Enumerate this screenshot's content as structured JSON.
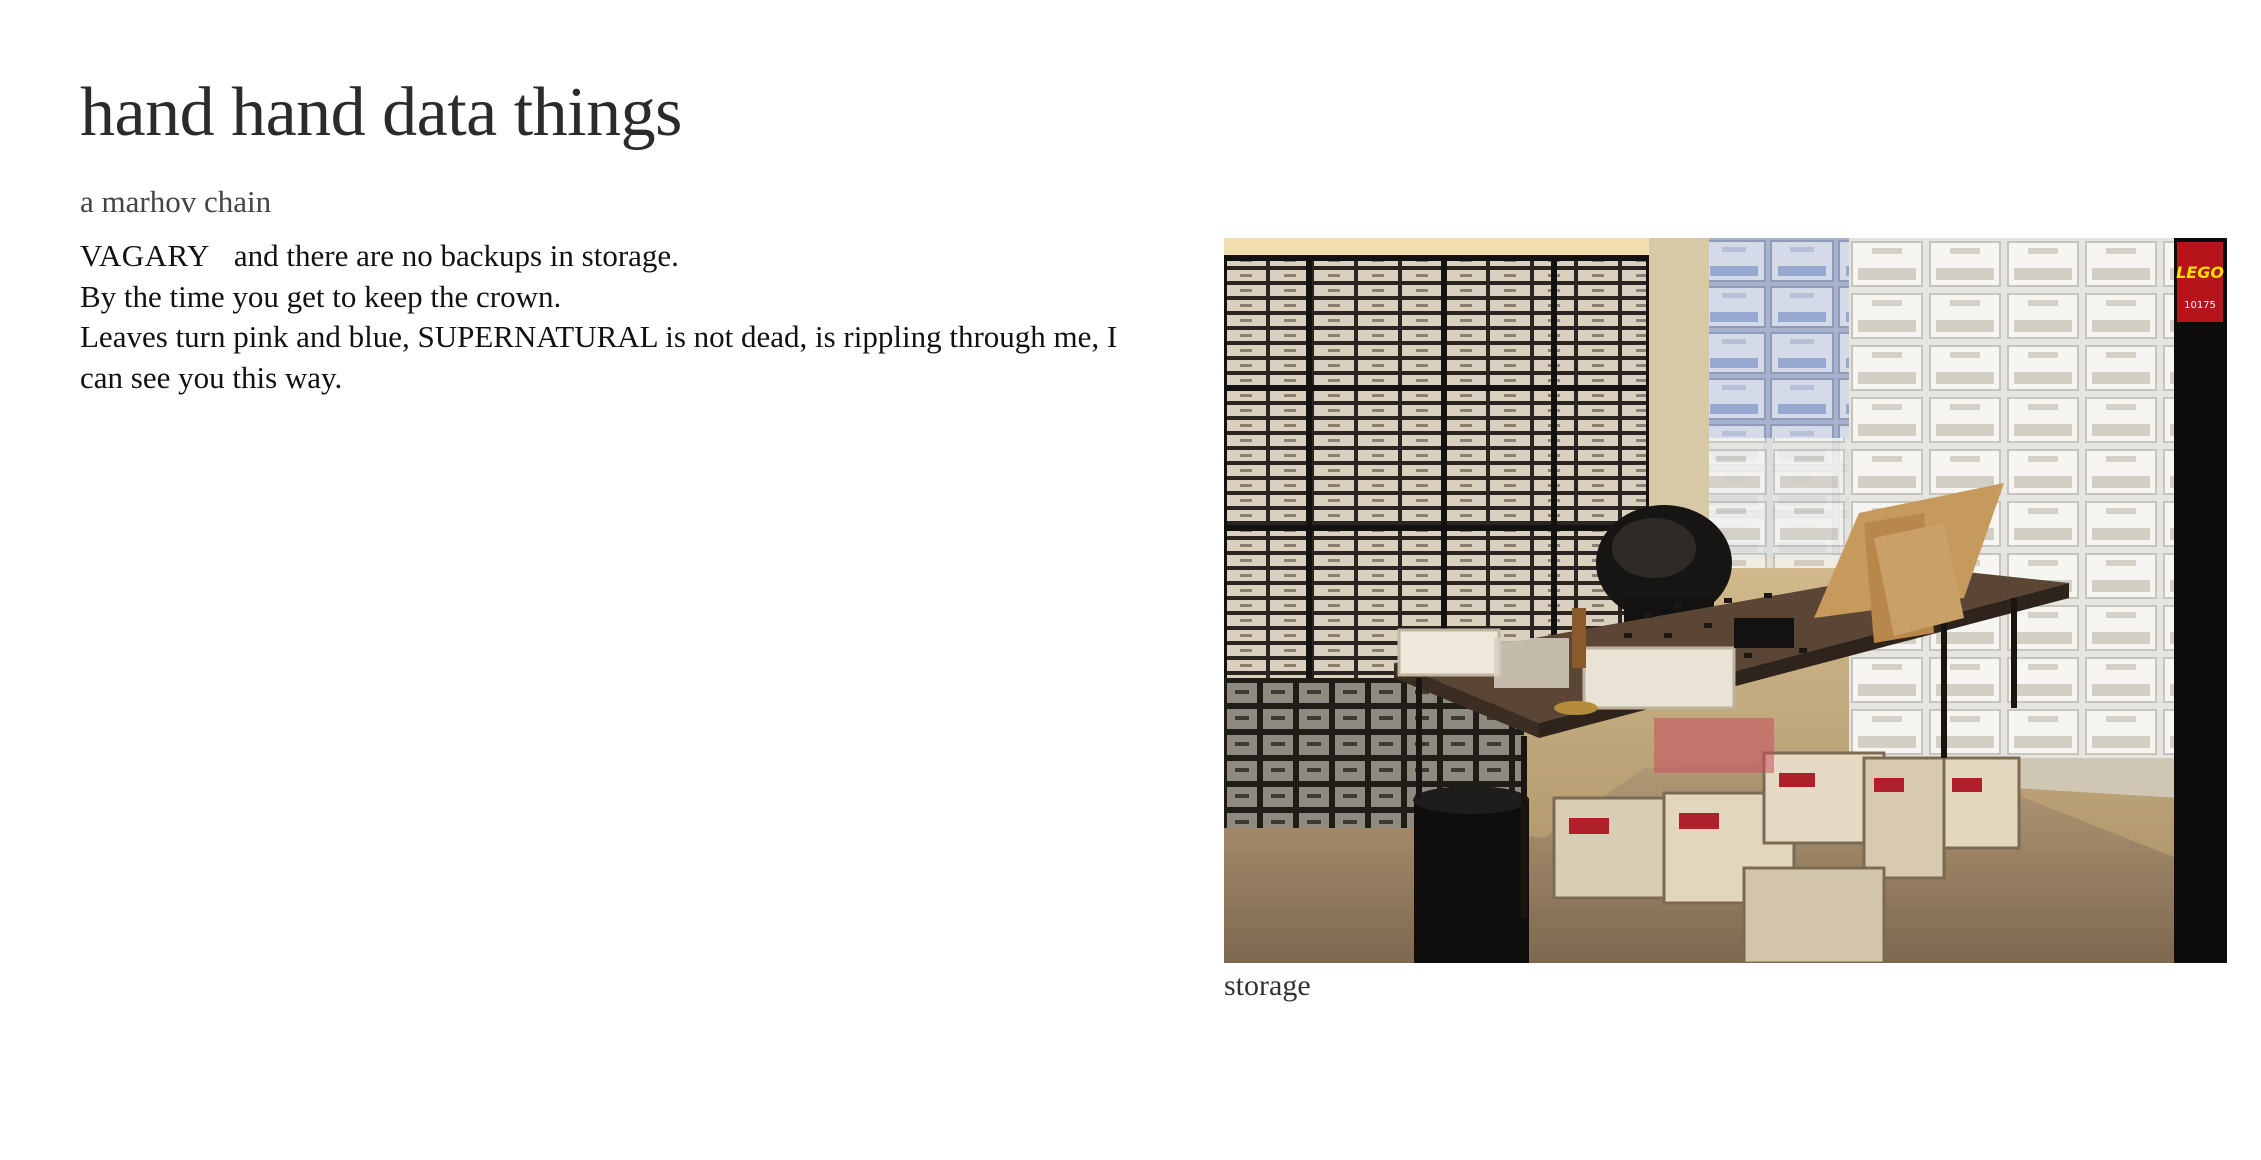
{
  "header": {
    "title": "hand hand data things",
    "subtitle": "a marhov chain"
  },
  "poem": {
    "term": "VAGARY",
    "line1_rest": "and there are no backups in storage.",
    "line2": "By the time you get to keep the crown.",
    "line3": "Leaves turn pink and blue, SUPERNATURAL is not dead, is rippling through me, I can see you this way."
  },
  "figure": {
    "caption": "storage",
    "logo_text": "LEGO",
    "logo_subtext": "10175"
  }
}
